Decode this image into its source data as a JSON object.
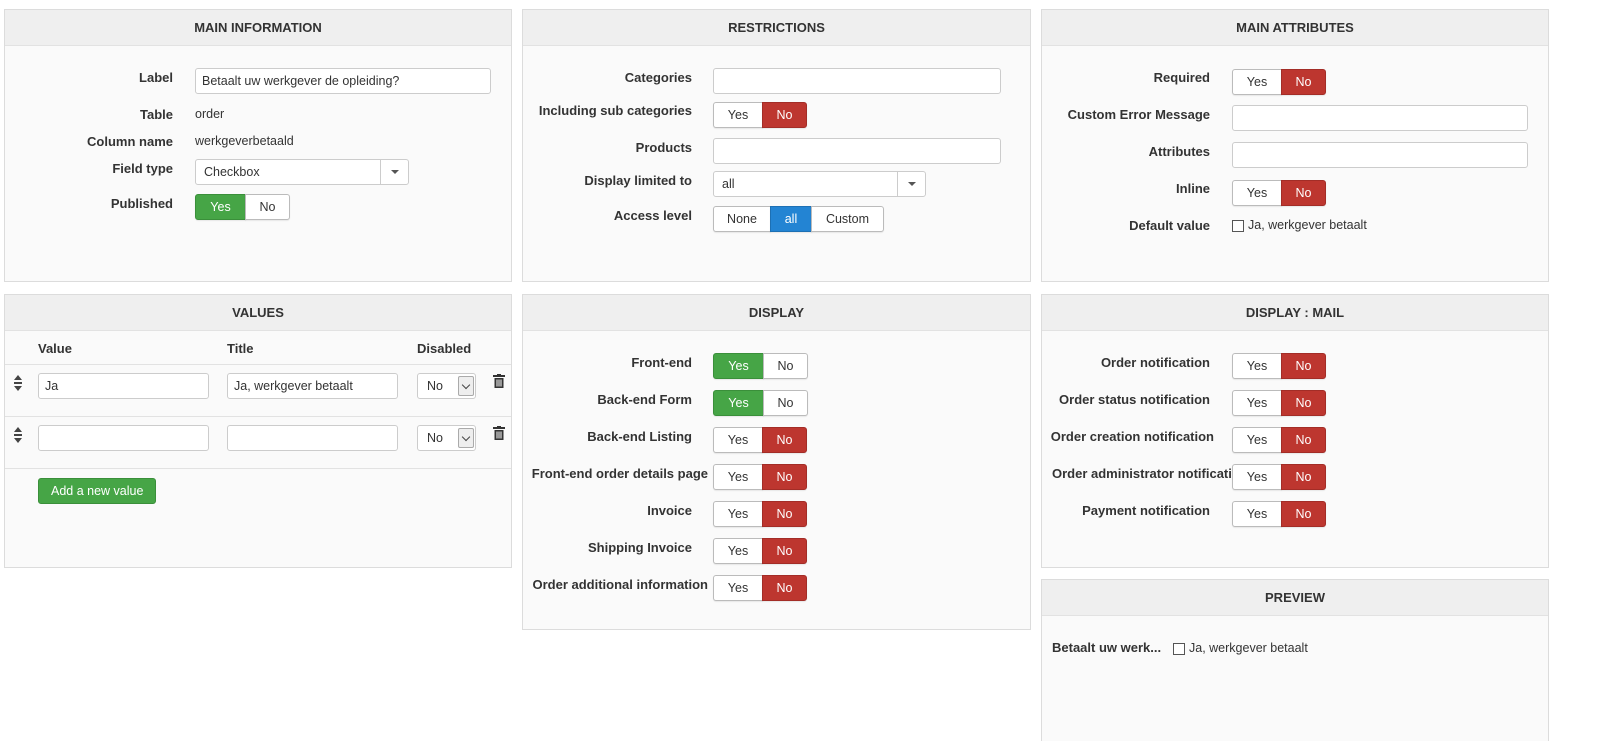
{
  "main_info": {
    "title": "MAIN INFORMATION",
    "label_label": "Label",
    "label_value": "Betaalt uw werkgever de opleiding?",
    "table_label": "Table",
    "table_value": "order",
    "column_label": "Column name",
    "column_value": "werkgeverbetaald",
    "field_type_label": "Field type",
    "field_type_value": "Checkbox",
    "published_label": "Published",
    "published_yes": "Yes",
    "published_no": "No"
  },
  "restrictions": {
    "title": "RESTRICTIONS",
    "categories_label": "Categories",
    "categories_value": "",
    "sub_categories_label": "Including sub categories",
    "sub_yes": "Yes",
    "sub_no": "No",
    "products_label": "Products",
    "products_value": "",
    "display_limited_label": "Display limited to",
    "display_limited_value": "all",
    "access_label": "Access level",
    "access_none": "None",
    "access_all": "all",
    "access_custom": "Custom"
  },
  "main_attributes": {
    "title": "MAIN ATTRIBUTES",
    "required_label": "Required",
    "required_yes": "Yes",
    "required_no": "No",
    "error_label": "Custom Error Message",
    "error_value": "",
    "attributes_label": "Attributes",
    "attributes_value": "",
    "inline_label": "Inline",
    "inline_yes": "Yes",
    "inline_no": "No",
    "default_label": "Default value",
    "default_option": "Ja, werkgever betaalt"
  },
  "values": {
    "title": "VALUES",
    "col_value": "Value",
    "col_title": "Title",
    "col_disabled": "Disabled",
    "rows": [
      {
        "value": "Ja",
        "title": "Ja, werkgever betaalt",
        "disabled": "No"
      },
      {
        "value": "",
        "title": "",
        "disabled": "No"
      }
    ],
    "add_button": "Add a new value"
  },
  "display": {
    "title": "DISPLAY",
    "rows": [
      {
        "label": "Front-end",
        "yes": "Yes",
        "no": "No",
        "selected": "yes"
      },
      {
        "label": "Back-end Form",
        "yes": "Yes",
        "no": "No",
        "selected": "yes"
      },
      {
        "label": "Back-end Listing",
        "yes": "Yes",
        "no": "No",
        "selected": "no"
      },
      {
        "label": "Front-end order details page",
        "yes": "Yes",
        "no": "No",
        "selected": "no"
      },
      {
        "label": "Invoice",
        "yes": "Yes",
        "no": "No",
        "selected": "no"
      },
      {
        "label": "Shipping Invoice",
        "yes": "Yes",
        "no": "No",
        "selected": "no"
      },
      {
        "label": "Order additional information",
        "yes": "Yes",
        "no": "No",
        "selected": "no"
      }
    ]
  },
  "display_mail": {
    "title": "DISPLAY : MAIL",
    "rows": [
      {
        "label": "Order notification",
        "yes": "Yes",
        "no": "No",
        "selected": "no"
      },
      {
        "label": "Order status notification",
        "yes": "Yes",
        "no": "No",
        "selected": "no"
      },
      {
        "label": "Order creation notification",
        "yes": "Yes",
        "no": "No",
        "selected": "no"
      },
      {
        "label": "Order administrator notification",
        "yes": "Yes",
        "no": "No",
        "selected": "no"
      },
      {
        "label": "Payment notification",
        "yes": "Yes",
        "no": "No",
        "selected": "no"
      }
    ]
  },
  "preview": {
    "title": "PREVIEW",
    "label": "Betaalt uw werk...",
    "option": "Ja, werkgever betaalt"
  },
  "colors": {
    "green": "#46a546",
    "red": "#bd362f",
    "blue": "#2384d3"
  }
}
